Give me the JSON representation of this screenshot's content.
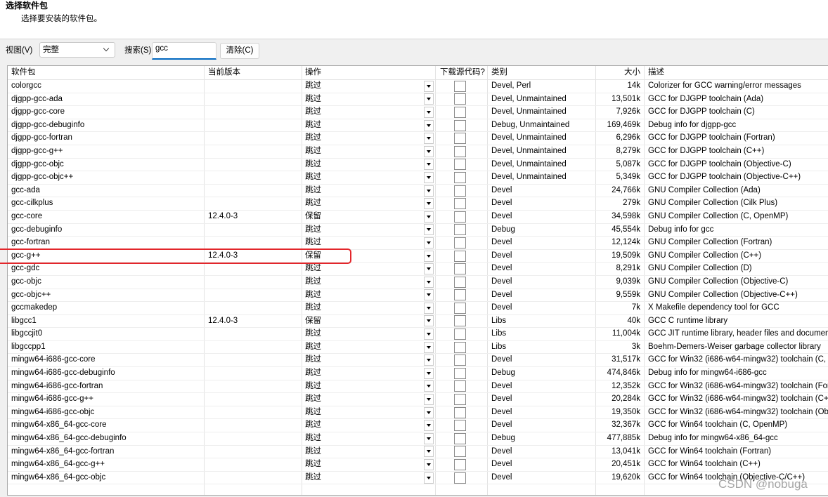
{
  "header": {
    "title": "选择软件包",
    "subtitle": "选择要安装的软件包。"
  },
  "toolbar": {
    "view_label": "视图(V)",
    "view_value": "完整",
    "search_label": "搜索(S)",
    "search_value": "gcc",
    "clear_label": "清除(C)",
    "accent_color": "#0067c0"
  },
  "columns": {
    "package": "软件包",
    "current_version": "当前版本",
    "action": "操作",
    "download_source": "下载源代码?",
    "category": "类别",
    "size": "大小",
    "description": "描述"
  },
  "rows": [
    {
      "package": "colorgcc",
      "current_version": "",
      "action": "跳过",
      "source_checked": false,
      "category": "Devel, Perl",
      "size": "14k",
      "description": "Colorizer for GCC warning/error messages"
    },
    {
      "package": "djgpp-gcc-ada",
      "current_version": "",
      "action": "跳过",
      "source_checked": false,
      "category": "Devel, Unmaintained",
      "size": "13,501k",
      "description": "GCC for DJGPP toolchain (Ada)"
    },
    {
      "package": "djgpp-gcc-core",
      "current_version": "",
      "action": "跳过",
      "source_checked": false,
      "category": "Devel, Unmaintained",
      "size": "7,926k",
      "description": "GCC for DJGPP toolchain (C)"
    },
    {
      "package": "djgpp-gcc-debuginfo",
      "current_version": "",
      "action": "跳过",
      "source_checked": false,
      "category": "Debug, Unmaintained",
      "size": "169,469k",
      "description": "Debug info for djgpp-gcc"
    },
    {
      "package": "djgpp-gcc-fortran",
      "current_version": "",
      "action": "跳过",
      "source_checked": false,
      "category": "Devel, Unmaintained",
      "size": "6,296k",
      "description": "GCC for DJGPP toolchain (Fortran)"
    },
    {
      "package": "djgpp-gcc-g++",
      "current_version": "",
      "action": "跳过",
      "source_checked": false,
      "category": "Devel, Unmaintained",
      "size": "8,279k",
      "description": "GCC for DJGPP toolchain (C++)"
    },
    {
      "package": "djgpp-gcc-objc",
      "current_version": "",
      "action": "跳过",
      "source_checked": false,
      "category": "Devel, Unmaintained",
      "size": "5,087k",
      "description": "GCC for DJGPP toolchain (Objective-C)"
    },
    {
      "package": "djgpp-gcc-objc++",
      "current_version": "",
      "action": "跳过",
      "source_checked": false,
      "category": "Devel, Unmaintained",
      "size": "5,349k",
      "description": "GCC for DJGPP toolchain (Objective-C++)"
    },
    {
      "package": "gcc-ada",
      "current_version": "",
      "action": "跳过",
      "source_checked": false,
      "category": "Devel",
      "size": "24,766k",
      "description": "GNU Compiler Collection (Ada)"
    },
    {
      "package": "gcc-cilkplus",
      "current_version": "",
      "action": "跳过",
      "source_checked": false,
      "category": "Devel",
      "size": "279k",
      "description": "GNU Compiler Collection (Cilk Plus)"
    },
    {
      "package": "gcc-core",
      "current_version": "12.4.0-3",
      "action": "保留",
      "source_checked": false,
      "category": "Devel",
      "size": "34,598k",
      "description": "GNU Compiler Collection (C, OpenMP)"
    },
    {
      "package": "gcc-debuginfo",
      "current_version": "",
      "action": "跳过",
      "source_checked": false,
      "category": "Debug",
      "size": "45,554k",
      "description": "Debug info for gcc"
    },
    {
      "package": "gcc-fortran",
      "current_version": "",
      "action": "跳过",
      "source_checked": false,
      "category": "Devel",
      "size": "12,124k",
      "description": "GNU Compiler Collection (Fortran)"
    },
    {
      "package": "gcc-g++",
      "current_version": "12.4.0-3",
      "action": "保留",
      "source_checked": false,
      "category": "Devel",
      "size": "19,509k",
      "description": "GNU Compiler Collection (C++)",
      "highlighted": true
    },
    {
      "package": "gcc-gdc",
      "current_version": "",
      "action": "跳过",
      "source_checked": false,
      "category": "Devel",
      "size": "8,291k",
      "description": "GNU Compiler Collection (D)"
    },
    {
      "package": "gcc-objc",
      "current_version": "",
      "action": "跳过",
      "source_checked": false,
      "category": "Devel",
      "size": "9,039k",
      "description": "GNU Compiler Collection (Objective-C)"
    },
    {
      "package": "gcc-objc++",
      "current_version": "",
      "action": "跳过",
      "source_checked": false,
      "category": "Devel",
      "size": "9,559k",
      "description": "GNU Compiler Collection (Objective-C++)"
    },
    {
      "package": "gccmakedep",
      "current_version": "",
      "action": "跳过",
      "source_checked": false,
      "category": "Devel",
      "size": "7k",
      "description": "X Makefile dependency tool for GCC"
    },
    {
      "package": "libgcc1",
      "current_version": "12.4.0-3",
      "action": "保留",
      "source_checked": false,
      "category": "Libs",
      "size": "40k",
      "description": "GCC C runtime library"
    },
    {
      "package": "libgccjit0",
      "current_version": "",
      "action": "跳过",
      "source_checked": false,
      "category": "Libs",
      "size": "11,004k",
      "description": "GCC JIT runtime library, header files and documen"
    },
    {
      "package": "libgccpp1",
      "current_version": "",
      "action": "跳过",
      "source_checked": false,
      "category": "Libs",
      "size": "3k",
      "description": "Boehm-Demers-Weiser garbage collector library"
    },
    {
      "package": "mingw64-i686-gcc-core",
      "current_version": "",
      "action": "跳过",
      "source_checked": false,
      "category": "Devel",
      "size": "31,517k",
      "description": "GCC for Win32 (i686-w64-mingw32) toolchain (C, O"
    },
    {
      "package": "mingw64-i686-gcc-debuginfo",
      "current_version": "",
      "action": "跳过",
      "source_checked": false,
      "category": "Debug",
      "size": "474,846k",
      "description": "Debug info for mingw64-i686-gcc"
    },
    {
      "package": "mingw64-i686-gcc-fortran",
      "current_version": "",
      "action": "跳过",
      "source_checked": false,
      "category": "Devel",
      "size": "12,352k",
      "description": "GCC for Win32 (i686-w64-mingw32) toolchain (For"
    },
    {
      "package": "mingw64-i686-gcc-g++",
      "current_version": "",
      "action": "跳过",
      "source_checked": false,
      "category": "Devel",
      "size": "20,284k",
      "description": "GCC for Win32 (i686-w64-mingw32) toolchain (C+"
    },
    {
      "package": "mingw64-i686-gcc-objc",
      "current_version": "",
      "action": "跳过",
      "source_checked": false,
      "category": "Devel",
      "size": "19,350k",
      "description": "GCC for Win32 (i686-w64-mingw32) toolchain (Obj"
    },
    {
      "package": "mingw64-x86_64-gcc-core",
      "current_version": "",
      "action": "跳过",
      "source_checked": false,
      "category": "Devel",
      "size": "32,367k",
      "description": "GCC for Win64 toolchain (C, OpenMP)"
    },
    {
      "package": "mingw64-x86_64-gcc-debuginfo",
      "current_version": "",
      "action": "跳过",
      "source_checked": false,
      "category": "Debug",
      "size": "477,885k",
      "description": "Debug info for mingw64-x86_64-gcc"
    },
    {
      "package": "mingw64-x86_64-gcc-fortran",
      "current_version": "",
      "action": "跳过",
      "source_checked": false,
      "category": "Devel",
      "size": "13,041k",
      "description": "GCC for Win64 toolchain (Fortran)"
    },
    {
      "package": "mingw64-x86_64-gcc-g++",
      "current_version": "",
      "action": "跳过",
      "source_checked": false,
      "category": "Devel",
      "size": "20,451k",
      "description": "GCC for Win64 toolchain (C++)"
    },
    {
      "package": "mingw64-x86_64-gcc-objc",
      "current_version": "",
      "action": "跳过",
      "source_checked": false,
      "category": "Devel",
      "size": "19,620k",
      "description": "GCC for Win64 toolchain (Objective-C/C++)"
    }
  ],
  "annotation": {
    "highlight_color": "#e3262b"
  },
  "watermark": "CSDN @nobuga"
}
